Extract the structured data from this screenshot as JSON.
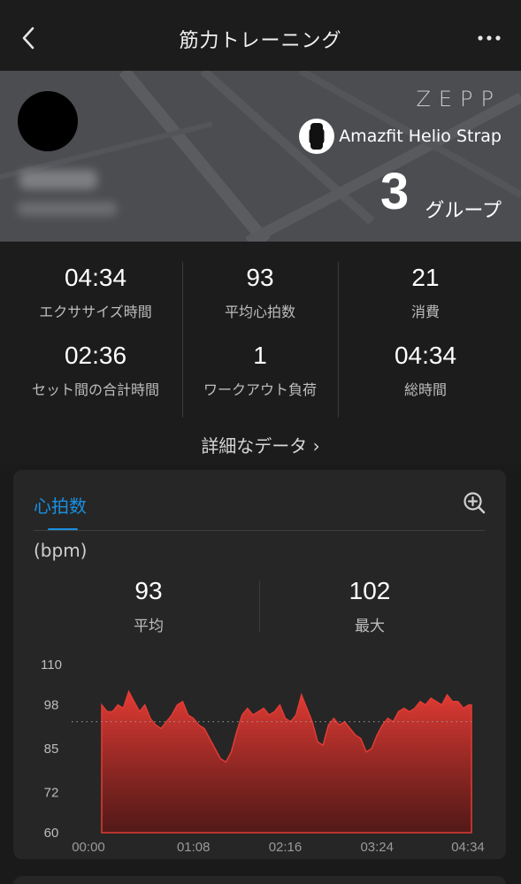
{
  "header": {
    "title": "筋力トレーニング"
  },
  "banner": {
    "brand": "ZEPP",
    "device_name": "Amazfit Helio Strap",
    "group_count": "3",
    "group_unit": "グループ"
  },
  "stats": [
    {
      "value": "04:34",
      "label": "エクササイズ時間"
    },
    {
      "value": "93",
      "label": "平均心拍数"
    },
    {
      "value": "21",
      "label": "消費"
    },
    {
      "value": "02:36",
      "label": "セット間の合計時間"
    },
    {
      "value": "1",
      "label": "ワークアウト負荷"
    },
    {
      "value": "04:34",
      "label": "総時間"
    }
  ],
  "details_link": "詳細なデータ ›",
  "heart_rate": {
    "tab_label": "心拍数",
    "unit": "(bpm)",
    "average": {
      "value": "93",
      "label": "平均"
    },
    "max": {
      "value": "102",
      "label": "最大"
    }
  },
  "chart_data": {
    "type": "area",
    "title": "",
    "xlabel": "",
    "ylabel": "",
    "x_ticks": [
      "00:00",
      "01:08",
      "02:16",
      "03:24",
      "04:34"
    ],
    "y_ticks": [
      110,
      98,
      85,
      72,
      60
    ],
    "ylim": [
      60,
      110
    ],
    "xlim": [
      0,
      274
    ],
    "average_line": 93,
    "color": "#e23b34",
    "series": [
      {
        "x": [
          0,
          4,
          8,
          12,
          16,
          20,
          24,
          28,
          32,
          36,
          40,
          44,
          48,
          52,
          56,
          60,
          64,
          68,
          72,
          76,
          80,
          84,
          88,
          92,
          96,
          100,
          104,
          108,
          112,
          116,
          120,
          124,
          128,
          132,
          136,
          140,
          144,
          148,
          152,
          156,
          160,
          164,
          168,
          172,
          176,
          180,
          184,
          188,
          192,
          196,
          200,
          204,
          208,
          212,
          216,
          220,
          224,
          228,
          232,
          236,
          240,
          244,
          248,
          252,
          256,
          260,
          264,
          268,
          272,
          274
        ],
        "values": [
          98,
          96,
          96,
          98,
          97,
          102,
          99,
          96,
          98,
          94,
          92,
          91,
          93,
          95,
          98,
          99,
          95,
          94,
          92,
          91,
          88,
          85,
          82,
          81,
          84,
          90,
          95,
          97,
          95,
          96,
          97,
          95,
          96,
          98,
          94,
          93,
          95,
          101,
          97,
          93,
          87,
          86,
          92,
          94,
          92,
          93,
          91,
          89,
          88,
          84,
          85,
          89,
          92,
          94,
          93,
          96,
          97,
          96,
          97,
          99,
          98,
          100,
          99,
          98,
          101,
          99,
          99,
          97,
          98,
          98
        ]
      }
    ]
  },
  "colors": {
    "accent": "#1a8fe0",
    "chart_red": "#e23b34"
  }
}
